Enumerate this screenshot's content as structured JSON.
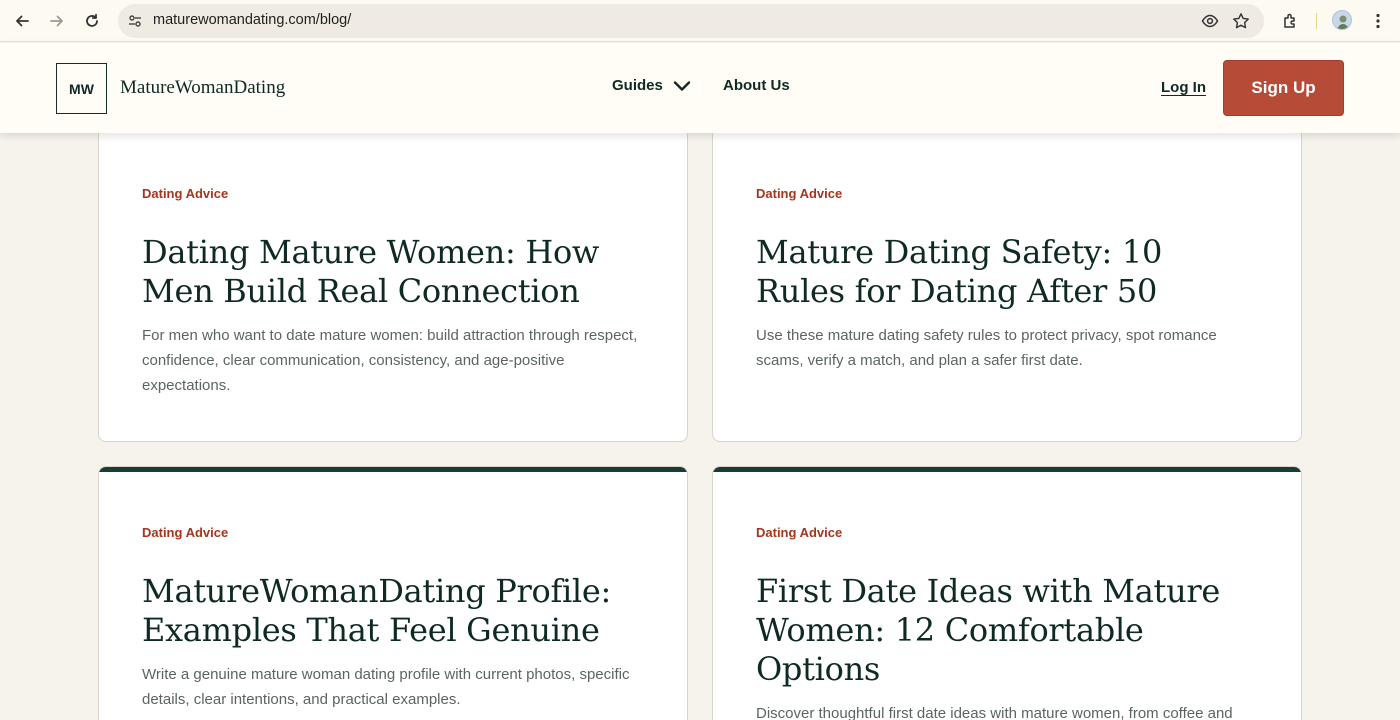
{
  "browser": {
    "url": "maturewomandating.com/blog/",
    "icons": [
      "back-arrow-icon",
      "forward-arrow-icon",
      "reload-icon",
      "site-settings-icon",
      "eye-icon",
      "star-icon",
      "extensions-icon",
      "profile-avatar",
      "menu-icon"
    ]
  },
  "header": {
    "logo_mark": "MW",
    "logo_text": "MatureWomanDating",
    "nav_guides": "Guides",
    "nav_about": "About Us",
    "login": "Log In",
    "signup": "Sign Up"
  },
  "colors": {
    "accent": "#b64b37",
    "category": "#a3361f",
    "ink": "#0f2a24",
    "card_topbar": "#173d34"
  },
  "cards": [
    {
      "category": "Dating Advice",
      "title": "Dating Mature Women: How Men Build Real Connection",
      "description": "For men who want to date mature women: build attraction through respect, confidence, clear communication, consistency, and age-positive expectations."
    },
    {
      "category": "Dating Advice",
      "title": "Mature Dating Safety: 10 Rules for Dating After 50",
      "description": "Use these mature dating safety rules to protect privacy, spot romance scams, verify a match, and plan a safer first date."
    },
    {
      "category": "Dating Advice",
      "title": "MatureWomanDating Profile: Examples That Feel Genuine",
      "description": "Write a genuine mature woman dating profile with current photos, specific details, clear intentions, and practical examples."
    },
    {
      "category": "Dating Advice",
      "title": "First Date Ideas with Mature Women: 12 Comfortable Options",
      "description": "Discover thoughtful first date ideas with mature women, from coffee and"
    }
  ]
}
